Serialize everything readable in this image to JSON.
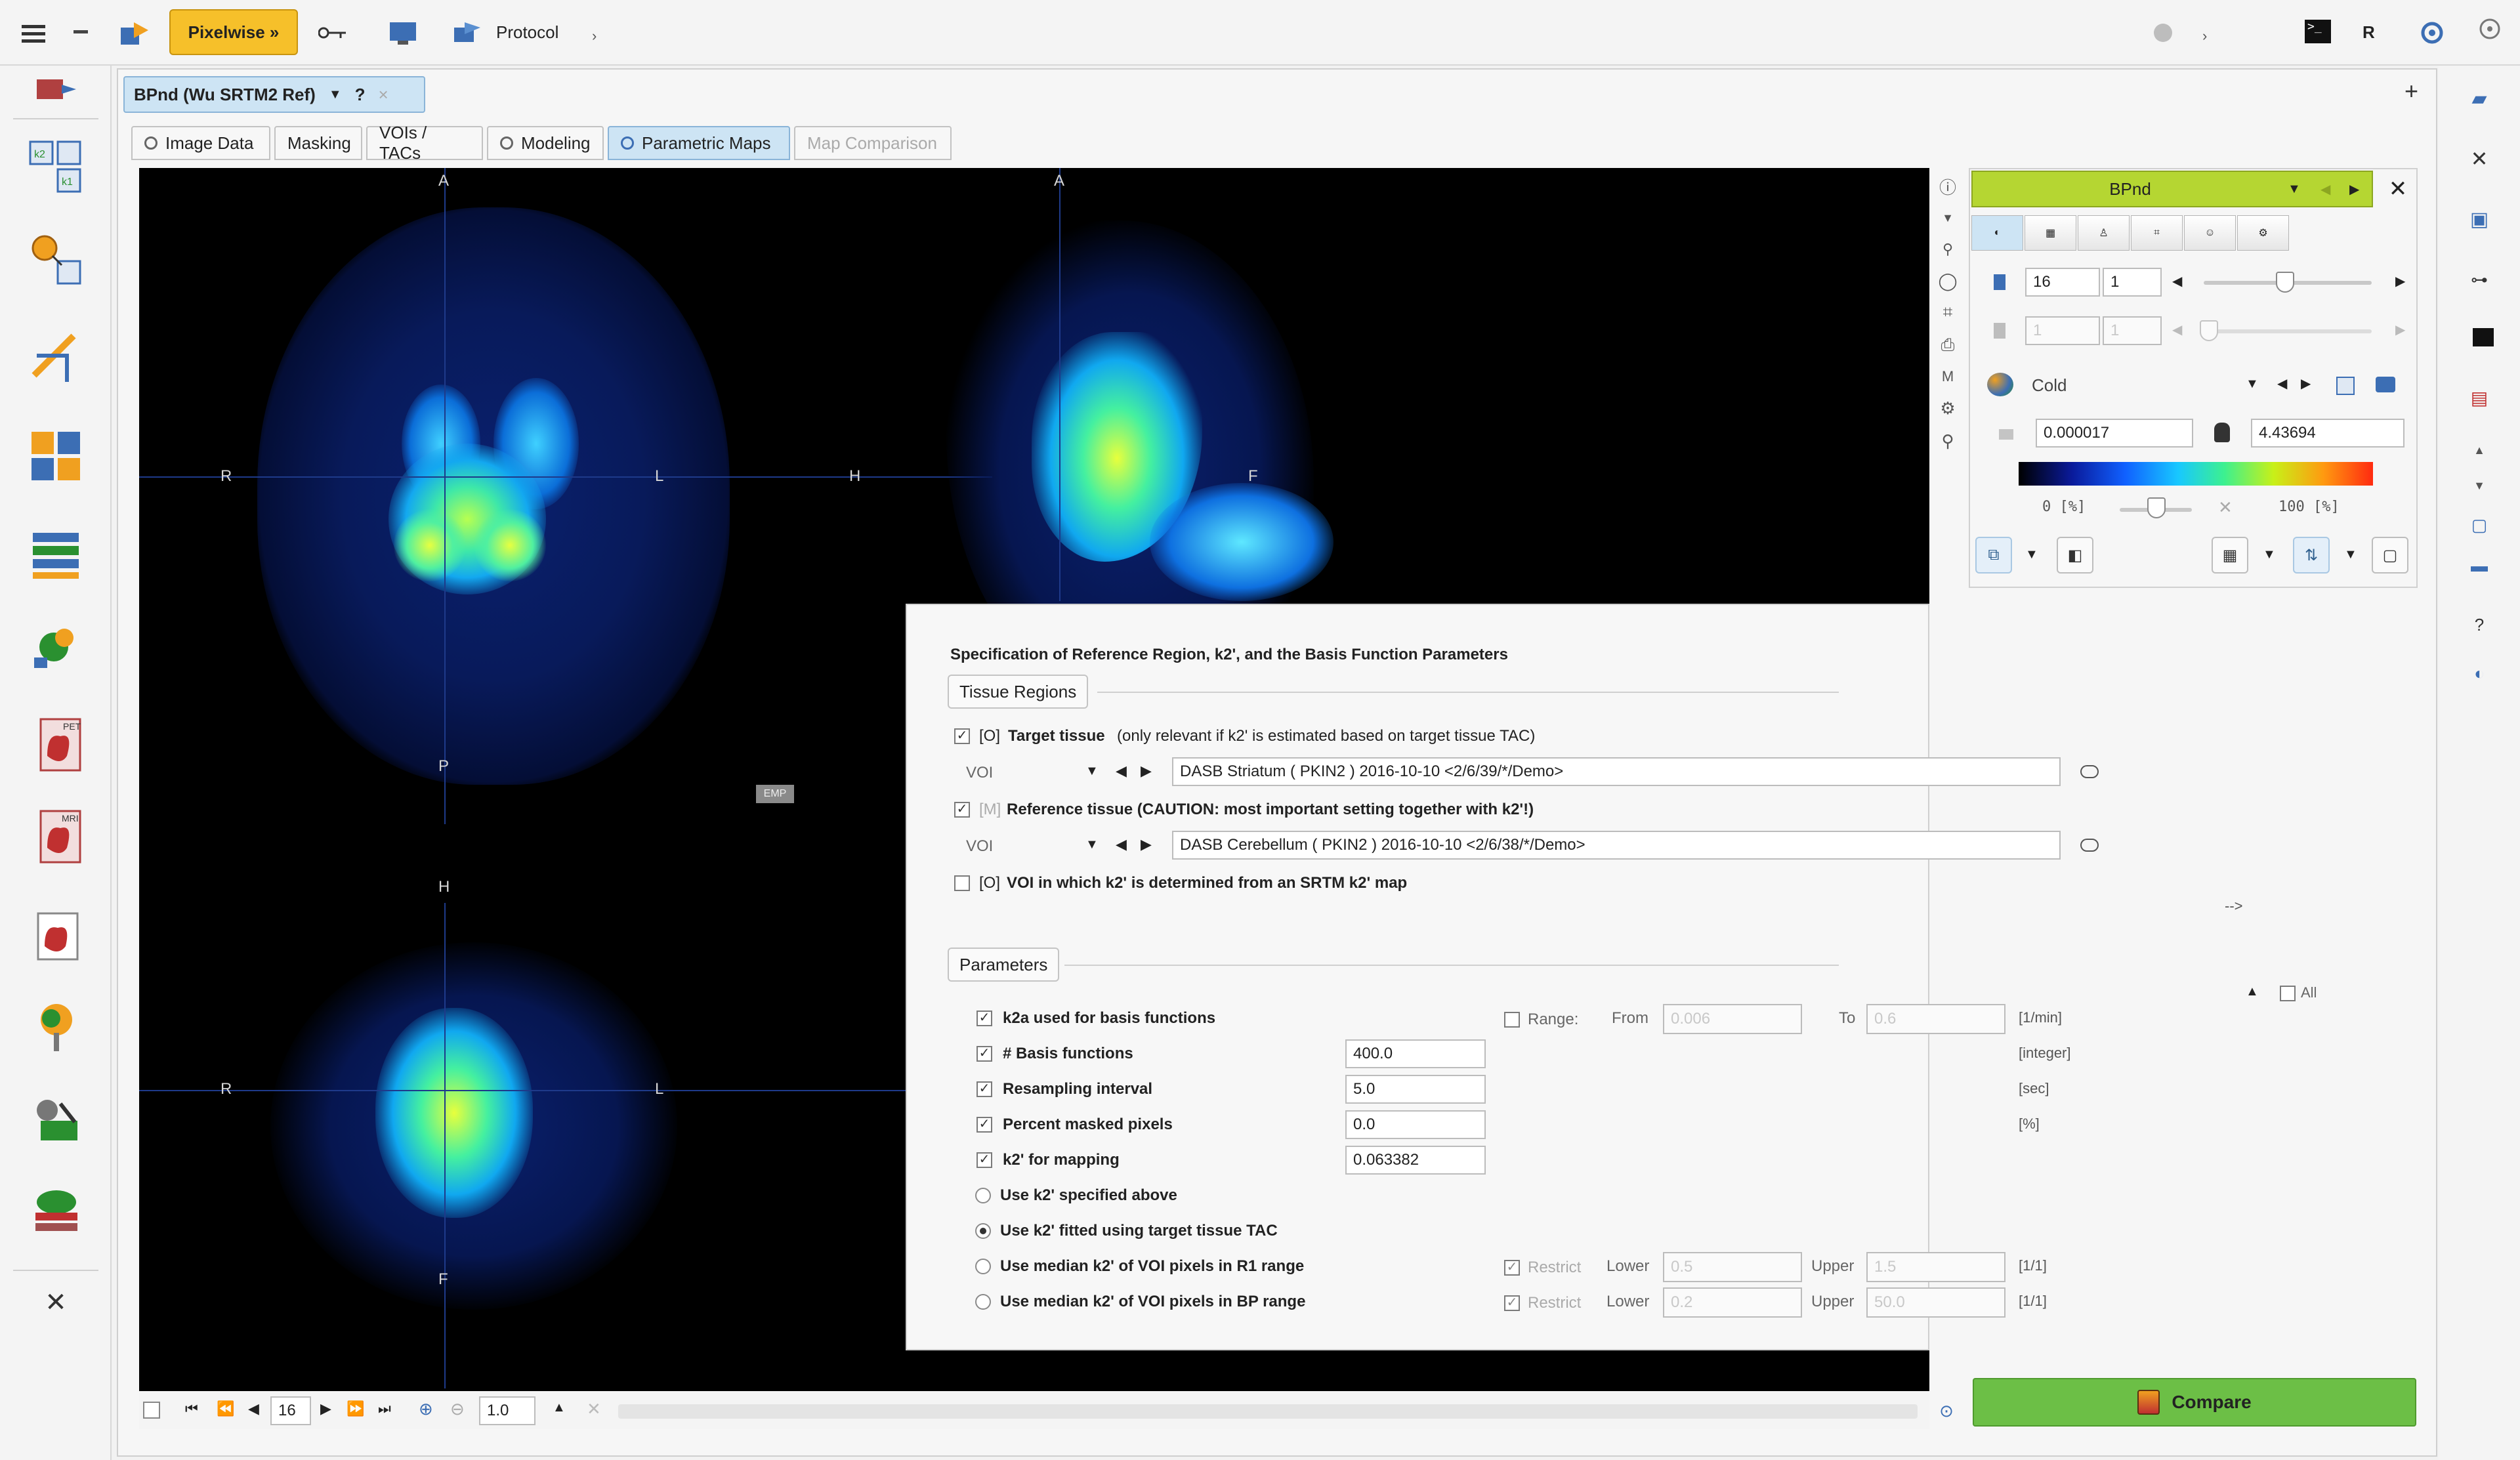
{
  "toolbar": {
    "pixelwise_label": "Pixelwise »",
    "protocol_label": "Protocol",
    "r_label": "R"
  },
  "window_tab": {
    "title": "BPnd (Wu SRTM2 Ref)",
    "help": "?"
  },
  "tabs": [
    {
      "label": "Image Data"
    },
    {
      "label": "Masking"
    },
    {
      "label": "VOIs / TACs"
    },
    {
      "label": "Modeling"
    },
    {
      "label": "Parametric Maps"
    },
    {
      "label": "Map Comparison"
    }
  ],
  "viewer": {
    "axial": {
      "top": "A",
      "bottom": "P",
      "left": "R",
      "right": "L"
    },
    "sagittal": {
      "top": "A",
      "left": "H",
      "right": "F"
    },
    "coronal": {
      "top": "H",
      "bottom": "F",
      "left": "R",
      "right": "L"
    },
    "emp_badge": "EMP"
  },
  "bottom_bar": {
    "slice": "16",
    "zoom": "1.0"
  },
  "right_panel": {
    "map_selector": "BPnd",
    "slice_value": "16",
    "slice_step": "1",
    "disabled_value_1": "1",
    "disabled_value_2": "1",
    "colortable": "Cold",
    "min_value": "0.000017",
    "max_value": "4.43694",
    "range_min_label": "0 [%]",
    "range_max_label": "100 [%]"
  },
  "dialog": {
    "title": "Specification of Reference Region, k2', and the Basis Function Parameters",
    "tissue_regions_label": "Tissue Regions",
    "target_tissue_prefix": "[O]",
    "target_tissue_bold": "Target tissue",
    "target_tissue_note": "(only relevant if k2' is estimated based on target tissue TAC)",
    "voi_label": "VOI",
    "target_voi_value": "DASB Striatum ( PKIN2 ) 2016-10-10 <2/6/39/*/Demo>",
    "reference_prefix": "[M]",
    "reference_text": "Reference tissue (CAUTION: most important setting together with k2'!)",
    "reference_voi_value": "DASB Cerebellum ( PKIN2 ) 2016-10-10 <2/6/38/*/Demo>",
    "k2_voi_prefix": "[O]",
    "k2_voi_text": "VOI in which k2' is determined from an SRTM k2' map",
    "arrow_label": "-->",
    "parameters_label": "Parameters",
    "all_label": "All",
    "params": [
      {
        "label": "k2a used for basis functions",
        "value": "",
        "unit": "[1/min]"
      },
      {
        "label": "# Basis functions",
        "value": "400.0",
        "unit": "[integer]"
      },
      {
        "label": "Resampling interval",
        "value": "5.0",
        "unit": "[sec]"
      },
      {
        "label": "Percent masked pixels",
        "value": "0.0",
        "unit": "[%]"
      },
      {
        "label": "k2' for mapping",
        "value": "0.063382",
        "unit": ""
      }
    ],
    "range_label": "Range:",
    "from_label": "From",
    "from_value": "0.006",
    "to_label": "To",
    "to_value": "0.6",
    "options": [
      {
        "label": "Use k2' specified above",
        "selected": false
      },
      {
        "label": "Use k2' fitted using target tissue TAC",
        "selected": true
      },
      {
        "label": "Use median k2' of VOI pixels in R1 range",
        "selected": false
      },
      {
        "label": "Use median k2' of VOI pixels in BP range",
        "selected": false
      }
    ],
    "restrict_label": "Restrict",
    "lower_label": "Lower",
    "upper_label": "Upper",
    "r1_lower": "0.5",
    "r1_upper": "1.5",
    "bp_lower": "0.2",
    "bp_upper": "50.0",
    "ratio_unit": "[1/1]"
  },
  "compare_button": "Compare",
  "colors": {
    "pixelwise_bg": "#f6c02a",
    "map_selector_bg": "#b5d632",
    "compare_bg": "#6cbf46",
    "active_tab": "#cde4f4",
    "viewer_bg": "#000000"
  }
}
